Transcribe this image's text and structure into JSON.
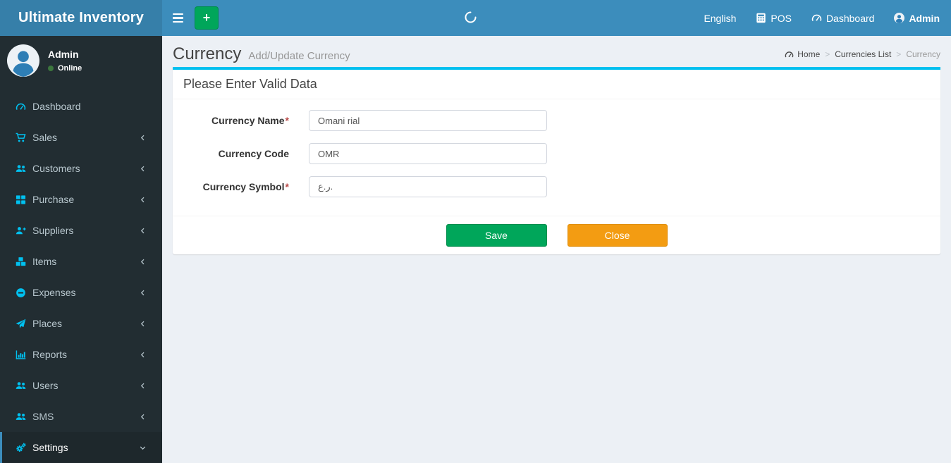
{
  "app": {
    "name": "Ultimate Inventory"
  },
  "navbar": {
    "add_button": "+",
    "language": "English",
    "pos": "POS",
    "dashboard": "Dashboard",
    "user": "Admin"
  },
  "sidebar": {
    "user": {
      "name": "Admin",
      "status": "Online"
    },
    "items": [
      {
        "label": "Dashboard"
      },
      {
        "label": "Sales"
      },
      {
        "label": "Customers"
      },
      {
        "label": "Purchase"
      },
      {
        "label": "Suppliers"
      },
      {
        "label": "Items"
      },
      {
        "label": "Expenses"
      },
      {
        "label": "Places"
      },
      {
        "label": "Reports"
      },
      {
        "label": "Users"
      },
      {
        "label": "SMS"
      },
      {
        "label": "Settings"
      }
    ]
  },
  "page": {
    "title": "Currency",
    "subtitle": "Add/Update Currency",
    "breadcrumb": {
      "home": "Home",
      "list": "Currencies List",
      "current": "Currency",
      "separator": ">"
    }
  },
  "form": {
    "heading": "Please Enter Valid Data",
    "required_marker": "*",
    "fields": [
      {
        "label": "Currency Name",
        "required": true,
        "value": "Omani rial"
      },
      {
        "label": "Currency Code",
        "required": false,
        "value": "OMR"
      },
      {
        "label": "Currency Symbol",
        "required": true,
        "value": "ر.ع."
      }
    ],
    "buttons": {
      "save": "Save",
      "close": "Close"
    }
  },
  "colors": {
    "navbar_blue": "#3c8dbc",
    "logo_blue": "#367fa9",
    "sidebar_dark": "#222d32",
    "sidebar_icon_cyan": "#00c0ef",
    "panel_accent_cyan": "#00c0ef",
    "save_green": "#00a65a",
    "close_orange": "#f39c12",
    "online_green": "#3c763d"
  }
}
